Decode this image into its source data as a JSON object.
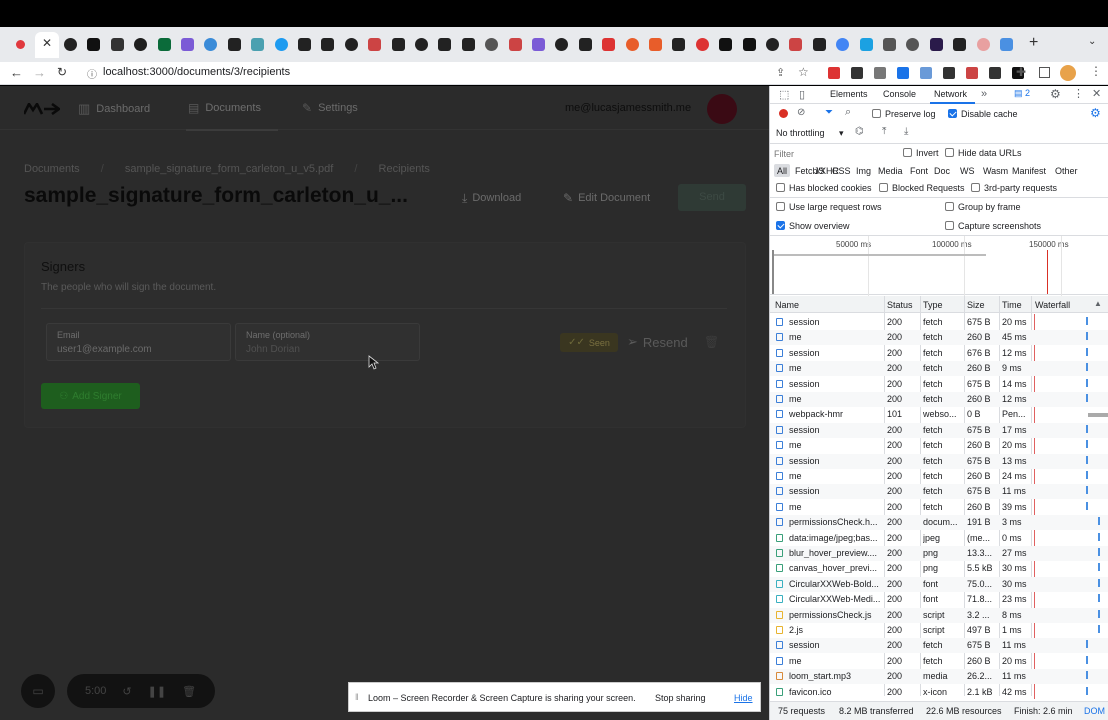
{
  "browser": {
    "url": "localhost:3000/documents/3/recipients",
    "tab_count": 43
  },
  "app": {
    "logo": "logo-mark",
    "nav": [
      {
        "label": "Dashboard",
        "icon": "bar-chart-icon"
      },
      {
        "label": "Documents",
        "icon": "document-icon"
      },
      {
        "label": "Settings",
        "icon": "wrench-icon"
      }
    ],
    "user_email": "me@lucasjamessmith.me",
    "breadcrumb": [
      "Documents",
      "sample_signature_form_carleton_u_v5.pdf",
      "Recipients"
    ],
    "title": "sample_signature_form_carleton_u_...",
    "actions": {
      "download": "Download",
      "edit": "Edit Document",
      "send": "Send"
    },
    "signers": {
      "heading": "Signers",
      "subheading": "The people who will sign the document.",
      "email_label": "Email",
      "email_value": "user1@example.com",
      "name_label": "Name (optional)",
      "name_value": "John Dorian",
      "status": "Seen",
      "resend": "Resend",
      "add_signer": "Add Signer"
    },
    "recorder": {
      "time": "5:00"
    },
    "loom_banner": {
      "text": "Loom – Screen Recorder & Screen Capture is sharing your screen.",
      "stop": "Stop sharing",
      "hide": "Hide"
    }
  },
  "devtools": {
    "tabs": [
      "Elements",
      "Console",
      "Network"
    ],
    "badge": "2",
    "preserve_log": "Preserve log",
    "disable_cache": "Disable cache",
    "throttling": "No throttling",
    "filter_placeholder": "Filter",
    "invert": "Invert",
    "hide_data_urls": "Hide data URLs",
    "types": [
      "All",
      "Fetch/XHR",
      "JS",
      "CSS",
      "Img",
      "Media",
      "Font",
      "Doc",
      "WS",
      "Wasm",
      "Manifest",
      "Other"
    ],
    "has_blocked_cookies": "Has blocked cookies",
    "blocked_requests": "Blocked Requests",
    "third_party": "3rd-party requests",
    "large_rows": "Use large request rows",
    "group_by_frame": "Group by frame",
    "show_overview": "Show overview",
    "capture_screenshots": "Capture screenshots",
    "timeline_ticks": [
      "50000 ms",
      "100000 ms",
      "150000 ms"
    ],
    "columns": [
      "Name",
      "Status",
      "Type",
      "Size",
      "Time",
      "Waterfall"
    ],
    "rows": [
      {
        "name": "session",
        "status": "200",
        "type": "fetch",
        "size": "675 B",
        "time": "20 ms",
        "icon": "fetch"
      },
      {
        "name": "me",
        "status": "200",
        "type": "fetch",
        "size": "260 B",
        "time": "45 ms",
        "icon": "fetch"
      },
      {
        "name": "session",
        "status": "200",
        "type": "fetch",
        "size": "676 B",
        "time": "12 ms",
        "icon": "fetch"
      },
      {
        "name": "me",
        "status": "200",
        "type": "fetch",
        "size": "260 B",
        "time": "9 ms",
        "icon": "fetch"
      },
      {
        "name": "session",
        "status": "200",
        "type": "fetch",
        "size": "675 B",
        "time": "14 ms",
        "icon": "fetch"
      },
      {
        "name": "me",
        "status": "200",
        "type": "fetch",
        "size": "260 B",
        "time": "12 ms",
        "icon": "fetch"
      },
      {
        "name": "webpack-hmr",
        "status": "101",
        "type": "webso...",
        "size": "0 B",
        "time": "Pen...",
        "icon": "fetch"
      },
      {
        "name": "session",
        "status": "200",
        "type": "fetch",
        "size": "675 B",
        "time": "17 ms",
        "icon": "fetch"
      },
      {
        "name": "me",
        "status": "200",
        "type": "fetch",
        "size": "260 B",
        "time": "20 ms",
        "icon": "fetch"
      },
      {
        "name": "session",
        "status": "200",
        "type": "fetch",
        "size": "675 B",
        "time": "13 ms",
        "icon": "fetch"
      },
      {
        "name": "me",
        "status": "200",
        "type": "fetch",
        "size": "260 B",
        "time": "24 ms",
        "icon": "fetch"
      },
      {
        "name": "session",
        "status": "200",
        "type": "fetch",
        "size": "675 B",
        "time": "11 ms",
        "icon": "fetch"
      },
      {
        "name": "me",
        "status": "200",
        "type": "fetch",
        "size": "260 B",
        "time": "39 ms",
        "icon": "fetch"
      },
      {
        "name": "permissionsCheck.h...",
        "status": "200",
        "type": "docum...",
        "size": "191 B",
        "time": "3 ms",
        "icon": "doc"
      },
      {
        "name": "data:image/jpeg;bas...",
        "status": "200",
        "type": "jpeg",
        "size": "(me...",
        "time": "0 ms",
        "icon": "img"
      },
      {
        "name": "blur_hover_preview....",
        "status": "200",
        "type": "png",
        "size": "13.3...",
        "time": "27 ms",
        "icon": "img"
      },
      {
        "name": "canvas_hover_previ...",
        "status": "200",
        "type": "png",
        "size": "5.5 kB",
        "time": "30 ms",
        "icon": "img"
      },
      {
        "name": "CircularXXWeb-Bold...",
        "status": "200",
        "type": "font",
        "size": "75.0...",
        "time": "30 ms",
        "icon": "font"
      },
      {
        "name": "CircularXXWeb-Medi...",
        "status": "200",
        "type": "font",
        "size": "71.8...",
        "time": "23 ms",
        "icon": "font"
      },
      {
        "name": "permissionsCheck.js",
        "status": "200",
        "type": "script",
        "size": "3.2 ...",
        "time": "8 ms",
        "icon": "script"
      },
      {
        "name": "2.js",
        "status": "200",
        "type": "script",
        "size": "497 B",
        "time": "1 ms",
        "icon": "script"
      },
      {
        "name": "session",
        "status": "200",
        "type": "fetch",
        "size": "675 B",
        "time": "11 ms",
        "icon": "fetch"
      },
      {
        "name": "me",
        "status": "200",
        "type": "fetch",
        "size": "260 B",
        "time": "20 ms",
        "icon": "fetch"
      },
      {
        "name": "loom_start.mp3",
        "status": "200",
        "type": "media",
        "size": "26.2...",
        "time": "11 ms",
        "icon": "media"
      },
      {
        "name": "favicon.ico",
        "status": "200",
        "type": "x-icon",
        "size": "2.1 kB",
        "time": "42 ms",
        "icon": "img"
      }
    ],
    "footer": {
      "requests": "75 requests",
      "transferred": "8.2 MB transferred",
      "resources": "22.6 MB resources",
      "finish": "Finish: 2.6 min",
      "dom": "DOM"
    }
  }
}
